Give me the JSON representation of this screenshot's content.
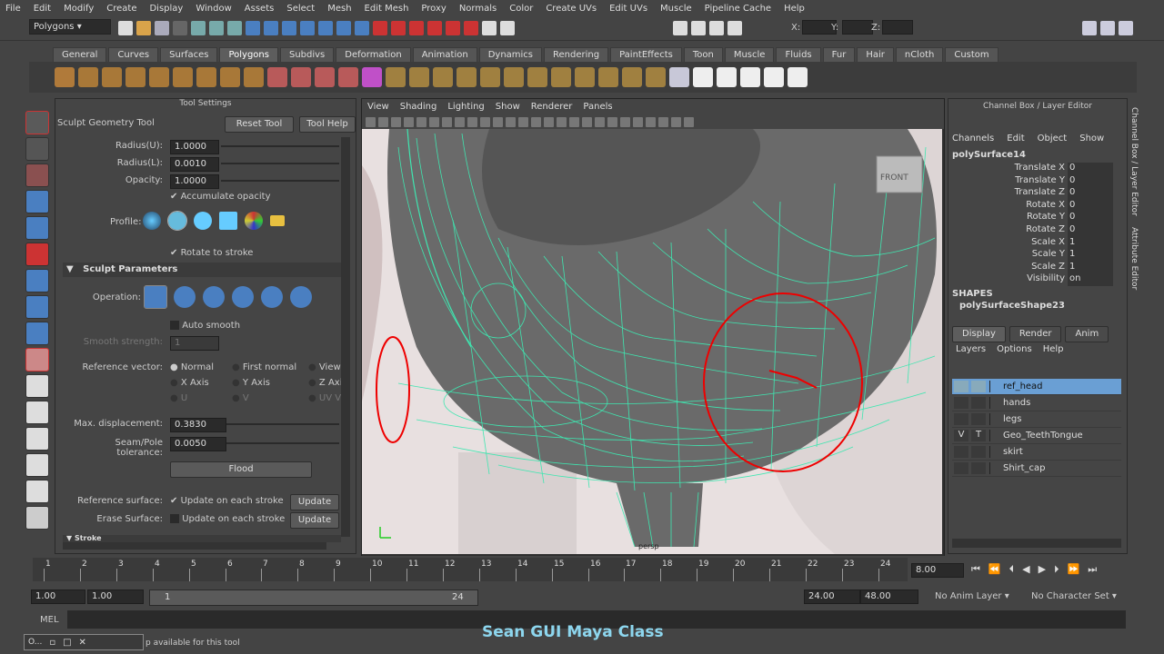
{
  "menu": [
    "File",
    "Edit",
    "Modify",
    "Create",
    "Display",
    "Window",
    "Assets",
    "Select",
    "Mesh",
    "Edit Mesh",
    "Proxy",
    "Normals",
    "Color",
    "Create UVs",
    "Edit UVs",
    "Muscle",
    "Pipeline Cache",
    "Help"
  ],
  "status": {
    "mode": "Polygons",
    "x_label": "X:",
    "y_label": "Y:",
    "z_label": "Z:"
  },
  "shelf_tabs": [
    "General",
    "Curves",
    "Surfaces",
    "Polygons",
    "Subdivs",
    "Deformation",
    "Animation",
    "Dynamics",
    "Rendering",
    "PaintEffects",
    "Toon",
    "Muscle",
    "Fluids",
    "Fur",
    "Hair",
    "nCloth",
    "Custom"
  ],
  "shelf_active": "Polygons",
  "tool_settings": {
    "panel_title": "Tool Settings",
    "tool_name": "Sculpt Geometry Tool",
    "reset_label": "Reset Tool",
    "help_label": "Tool Help",
    "radius_u_label": "Radius(U):",
    "radius_u": "1.0000",
    "radius_l_label": "Radius(L):",
    "radius_l": "0.0010",
    "opacity_label": "Opacity:",
    "opacity": "1.0000",
    "accumulate": "Accumulate opacity",
    "profile_label": "Profile:",
    "rotate_stroke": "Rotate to stroke",
    "section": "Sculpt Parameters",
    "operation_label": "Operation:",
    "auto_smooth": "Auto smooth",
    "smooth_strength_label": "Smooth strength:",
    "smooth_strength": "1",
    "ref_vector_label": "Reference vector:",
    "rv_normal": "Normal",
    "rv_first_normal": "First normal",
    "rv_view": "View",
    "rv_x": "X Axis",
    "rv_y": "Y Axis",
    "rv_z": "Z Axis",
    "rv_u": "U",
    "rv_v": "V",
    "rv_uv": "UV Ve",
    "max_disp_label": "Max. displacement:",
    "max_disp": "0.3830",
    "seam_label": "Seam/Pole tolerance:",
    "seam": "0.0050",
    "flood_label": "Flood",
    "ref_surface_label": "Reference surface:",
    "update_each": "Update on each stroke",
    "update_label": "Update",
    "erase_surface_label": "Erase Surface:",
    "stroke_section": "Stroke"
  },
  "viewport": {
    "menu": [
      "View",
      "Shading",
      "Lighting",
      "Show",
      "Renderer",
      "Panels"
    ],
    "cam_label": "persp",
    "cube_label": "FRONT"
  },
  "channel_box": {
    "title": "Channel Box / Layer Editor",
    "menu": [
      "Channels",
      "Edit",
      "Object",
      "Show"
    ],
    "object": "polySurface14",
    "attrs": [
      {
        "n": "Translate X",
        "v": "0"
      },
      {
        "n": "Translate Y",
        "v": "0"
      },
      {
        "n": "Translate Z",
        "v": "0"
      },
      {
        "n": "Rotate X",
        "v": "0"
      },
      {
        "n": "Rotate Y",
        "v": "0"
      },
      {
        "n": "Rotate Z",
        "v": "0"
      },
      {
        "n": "Scale X",
        "v": "1"
      },
      {
        "n": "Scale Y",
        "v": "1"
      },
      {
        "n": "Scale Z",
        "v": "1"
      },
      {
        "n": "Visibility",
        "v": "on"
      }
    ],
    "shapes_label": "SHAPES",
    "shape": "polySurfaceShape23",
    "tabs": [
      "Display",
      "Render",
      "Anim"
    ],
    "layer_menu": [
      "Layers",
      "Options",
      "Help"
    ],
    "layers": [
      {
        "name": "ref_head",
        "v": "",
        "t": "",
        "selected": true
      },
      {
        "name": "hands",
        "v": "",
        "t": ""
      },
      {
        "name": "legs",
        "v": "",
        "t": ""
      },
      {
        "name": "Geo_TeethTongue",
        "v": "V",
        "t": "T"
      },
      {
        "name": "skirt",
        "v": "",
        "t": ""
      },
      {
        "name": "Shirt_cap",
        "v": "",
        "t": ""
      }
    ],
    "side_tab1": "Channel Box / Layer Editor",
    "side_tab2": "Attribute Editor"
  },
  "timeline": {
    "ticks": [
      "1",
      "2",
      "3",
      "4",
      "5",
      "6",
      "7",
      "8",
      "9",
      "10",
      "11",
      "12",
      "13",
      "14",
      "15",
      "16",
      "17",
      "18",
      "19",
      "20",
      "21",
      "22",
      "23",
      "24"
    ],
    "current": "8.00"
  },
  "range": {
    "start": "1.00",
    "start2": "1.00",
    "slider_start": "1",
    "slider_end": "24",
    "end": "24.00",
    "end2": "48.00",
    "anim_layer": "No Anim Layer",
    "char_set": "No Character Set"
  },
  "cmd": {
    "label": "MEL",
    "help": "p available for this tool",
    "overlay": "Sean GUI Maya Class",
    "mini": "O..."
  }
}
